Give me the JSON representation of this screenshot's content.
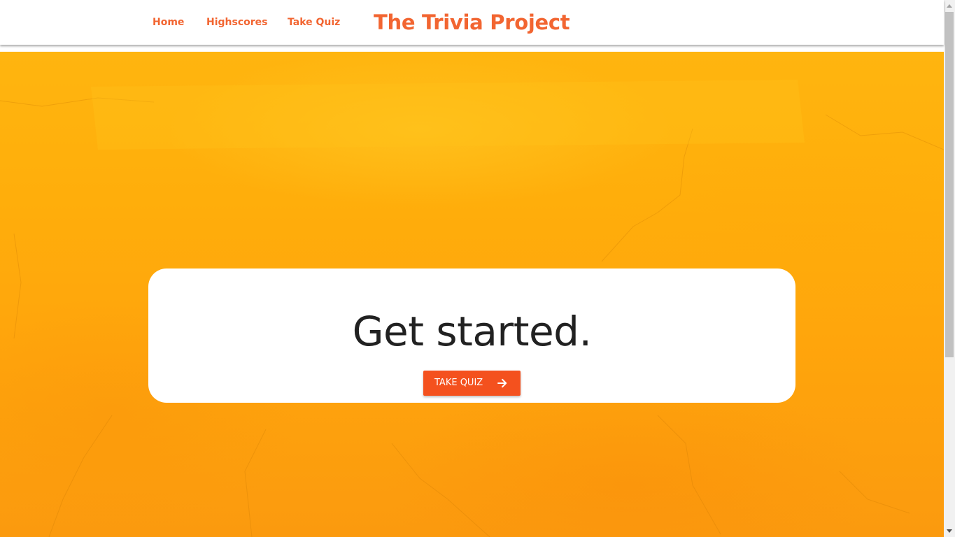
{
  "nav": {
    "links": [
      {
        "label": "Home"
      },
      {
        "label": "Highscores"
      },
      {
        "label": "Take Quiz"
      }
    ],
    "brand": "The Trivia Project"
  },
  "hero": {
    "heading": "Get started.",
    "cta_label": "TAKE QUIZ",
    "cta_icon": "arrow-right-icon"
  },
  "colors": {
    "accent": "#f26531",
    "button": "#f4511e",
    "background": "#ffab0d",
    "card": "#ffffff",
    "heading_text": "#212121"
  }
}
